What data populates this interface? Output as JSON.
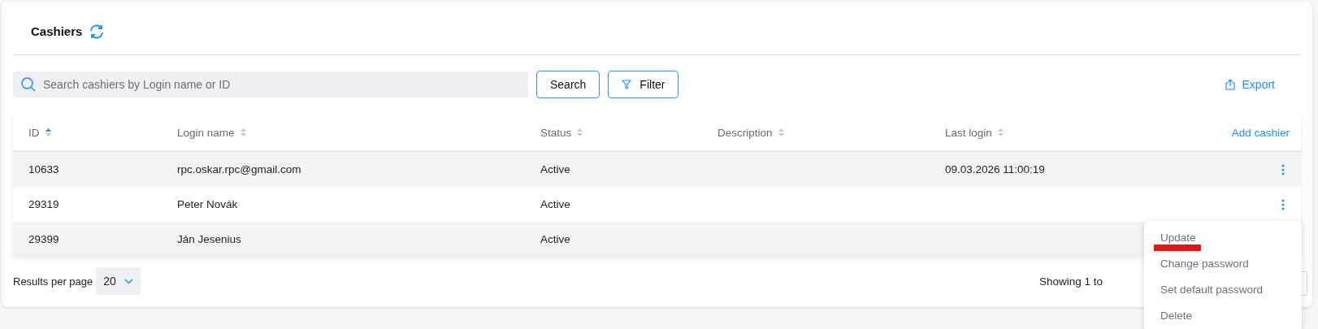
{
  "title": "Cashiers",
  "search": {
    "placeholder": "Search cashiers by Login name or ID"
  },
  "buttons": [
    {
      "label": "Search",
      "kind": "plain"
    },
    {
      "label": "Filter",
      "kind": "filter"
    }
  ],
  "export": {
    "label": "Export"
  },
  "table": {
    "columns": [
      {
        "label": "ID",
        "sorted": true
      },
      {
        "label": "Login name",
        "sorted": false
      },
      {
        "label": "Status",
        "sorted": false
      },
      {
        "label": "Description",
        "sorted": false
      },
      {
        "label": "Last login",
        "sorted": false
      }
    ],
    "add_label": "Add cashier",
    "rows": [
      {
        "id": "10633",
        "login": "rpc.oskar.rpc@gmail.com",
        "status": "Active",
        "last_login": "09.03.2026 11:00:19"
      },
      {
        "id": "29319",
        "login": "Peter Novák",
        "status": "Active"
      },
      {
        "id": "29399",
        "login": "Ján Jesenius",
        "status": "Active"
      }
    ]
  },
  "footer": {
    "per_page_label": "Results per page",
    "per_page": "20",
    "showing": "Showing 1 to"
  },
  "menu": {
    "items": [
      {
        "label": "Update",
        "marked": true
      },
      {
        "label": "Change password",
        "marked": false
      },
      {
        "label": "Set default password",
        "marked": false
      },
      {
        "label": "Delete",
        "marked": false
      }
    ]
  }
}
